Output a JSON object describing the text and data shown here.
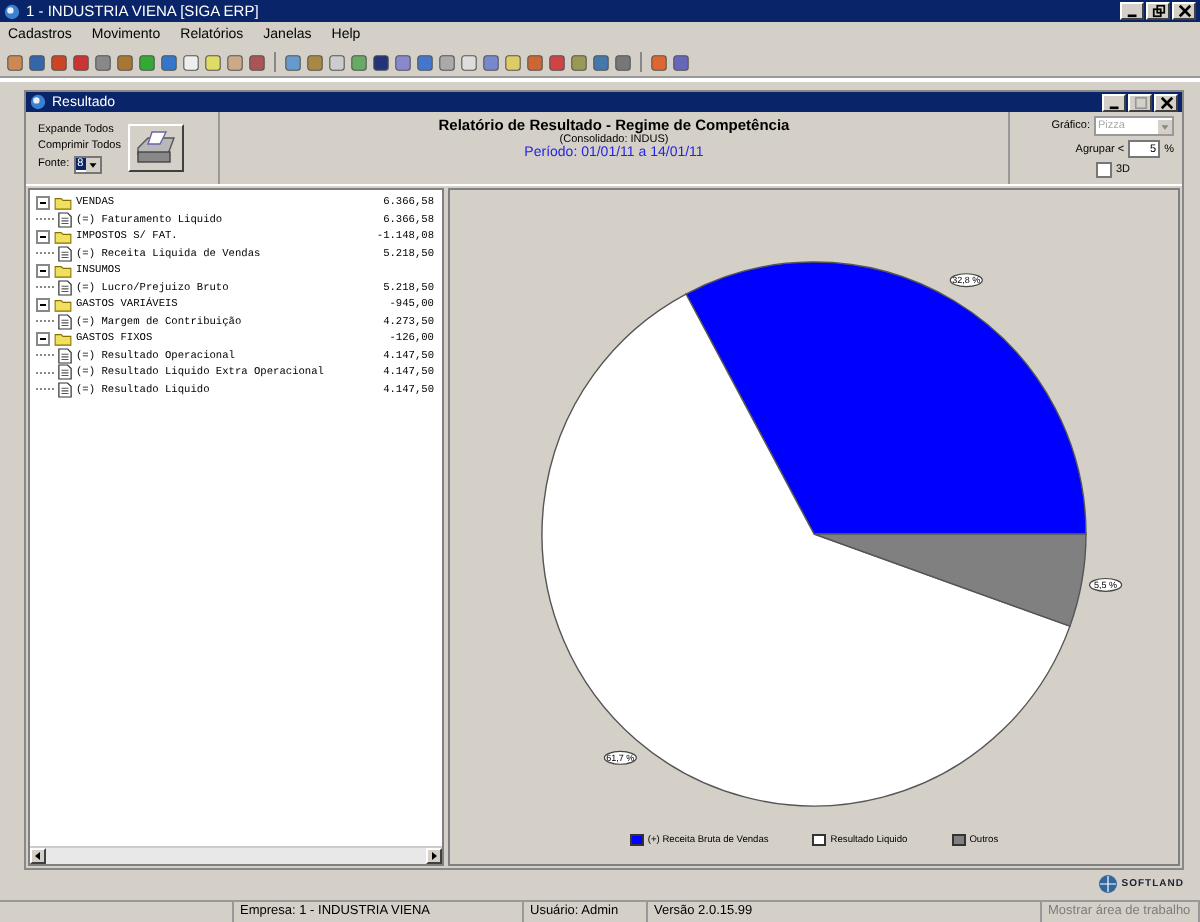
{
  "window": {
    "title": "1 - INDUSTRIA VIENA [SIGA ERP]"
  },
  "menu": [
    "Cadastros",
    "Movimento",
    "Relatórios",
    "Janelas",
    "Help"
  ],
  "child_window": {
    "title": "Resultado"
  },
  "left_controls": {
    "expand": "Expande Todos",
    "collapse": "Comprimir Todos",
    "font_label": "Fonte:",
    "font_value": "8"
  },
  "report": {
    "title": "Relatório de Resultado - Regime de Competência",
    "subtitle": "(Consolidado: INDUS)",
    "period": "Período: 01/01/11 a 14/01/11"
  },
  "chart_options": {
    "chart_label": "Gráfico:",
    "chart_value": "Pizza",
    "group_label": "Agrupar <",
    "group_value": "5",
    "group_unit": "%",
    "three_d_label": "3D",
    "three_d": false
  },
  "tree": [
    {
      "label": "VENDAS",
      "value": "6.366,58",
      "expanded": true,
      "children": [
        {
          "label": "(=) Faturamento Liquido",
          "value": "6.366,58"
        }
      ]
    },
    {
      "label": "IMPOSTOS S/ FAT.",
      "value": "-1.148,08",
      "expanded": true,
      "children": [
        {
          "label": "(=) Receita Liquida de Vendas",
          "value": "5.218,50"
        }
      ]
    },
    {
      "label": "INSUMOS",
      "expanded": true,
      "children": [
        {
          "label": "(=) Lucro/Prejuizo Bruto",
          "value": "5.218,50"
        }
      ]
    },
    {
      "label": "GASTOS VARIÁVEIS",
      "value": "-945,00",
      "expanded": true,
      "children": [
        {
          "label": "(=) Margem de Contribuição",
          "value": "4.273,50"
        }
      ]
    },
    {
      "label": "GASTOS FIXOS",
      "value": "-126,00",
      "expanded": true,
      "children": [
        {
          "label": "(=) Resultado Operacional",
          "value": "4.147,50"
        },
        {
          "label": "(=) Resultado Liquido Extra Operacional",
          "value": "4.147,50"
        },
        {
          "label": "(=) Resultado Liquido",
          "value": "4.147,50"
        }
      ]
    }
  ],
  "chart_data": {
    "type": "pie",
    "categories": [
      "(+) Receita Bruta de Vendas",
      "Resultado Liquido",
      "Outros"
    ],
    "values": [
      32.8,
      61.7,
      5.5
    ],
    "legend": true,
    "colors": [
      "#0000ff",
      "#ffffff",
      "#808080"
    ],
    "value_labels": [
      "32,8 %",
      "61,7 %",
      "5,5 %"
    ]
  },
  "brand": "SOFTLAND",
  "status_bar": [
    "Empresa: 1 - INDUSTRIA VIENA",
    "Usuário: Admin",
    "Versão 2.0.15.99"
  ],
  "show_desktop": {
    "label": "Mostrar área de trabalho",
    "disabled": true
  }
}
